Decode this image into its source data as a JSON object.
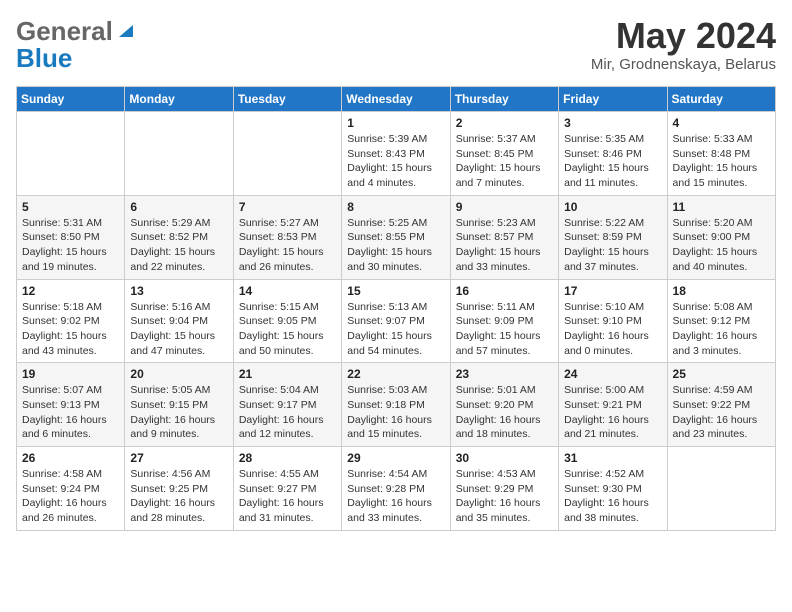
{
  "header": {
    "logo": {
      "general": "General",
      "blue": "Blue"
    },
    "month": "May 2024",
    "location": "Mir, Grodnenskaya, Belarus"
  },
  "weekdays": [
    "Sunday",
    "Monday",
    "Tuesday",
    "Wednesday",
    "Thursday",
    "Friday",
    "Saturday"
  ],
  "weeks": [
    [
      {
        "day": "",
        "info": ""
      },
      {
        "day": "",
        "info": ""
      },
      {
        "day": "",
        "info": ""
      },
      {
        "day": "1",
        "info": "Sunrise: 5:39 AM\nSunset: 8:43 PM\nDaylight: 15 hours\nand 4 minutes."
      },
      {
        "day": "2",
        "info": "Sunrise: 5:37 AM\nSunset: 8:45 PM\nDaylight: 15 hours\nand 7 minutes."
      },
      {
        "day": "3",
        "info": "Sunrise: 5:35 AM\nSunset: 8:46 PM\nDaylight: 15 hours\nand 11 minutes."
      },
      {
        "day": "4",
        "info": "Sunrise: 5:33 AM\nSunset: 8:48 PM\nDaylight: 15 hours\nand 15 minutes."
      }
    ],
    [
      {
        "day": "5",
        "info": "Sunrise: 5:31 AM\nSunset: 8:50 PM\nDaylight: 15 hours\nand 19 minutes."
      },
      {
        "day": "6",
        "info": "Sunrise: 5:29 AM\nSunset: 8:52 PM\nDaylight: 15 hours\nand 22 minutes."
      },
      {
        "day": "7",
        "info": "Sunrise: 5:27 AM\nSunset: 8:53 PM\nDaylight: 15 hours\nand 26 minutes."
      },
      {
        "day": "8",
        "info": "Sunrise: 5:25 AM\nSunset: 8:55 PM\nDaylight: 15 hours\nand 30 minutes."
      },
      {
        "day": "9",
        "info": "Sunrise: 5:23 AM\nSunset: 8:57 PM\nDaylight: 15 hours\nand 33 minutes."
      },
      {
        "day": "10",
        "info": "Sunrise: 5:22 AM\nSunset: 8:59 PM\nDaylight: 15 hours\nand 37 minutes."
      },
      {
        "day": "11",
        "info": "Sunrise: 5:20 AM\nSunset: 9:00 PM\nDaylight: 15 hours\nand 40 minutes."
      }
    ],
    [
      {
        "day": "12",
        "info": "Sunrise: 5:18 AM\nSunset: 9:02 PM\nDaylight: 15 hours\nand 43 minutes."
      },
      {
        "day": "13",
        "info": "Sunrise: 5:16 AM\nSunset: 9:04 PM\nDaylight: 15 hours\nand 47 minutes."
      },
      {
        "day": "14",
        "info": "Sunrise: 5:15 AM\nSunset: 9:05 PM\nDaylight: 15 hours\nand 50 minutes."
      },
      {
        "day": "15",
        "info": "Sunrise: 5:13 AM\nSunset: 9:07 PM\nDaylight: 15 hours\nand 54 minutes."
      },
      {
        "day": "16",
        "info": "Sunrise: 5:11 AM\nSunset: 9:09 PM\nDaylight: 15 hours\nand 57 minutes."
      },
      {
        "day": "17",
        "info": "Sunrise: 5:10 AM\nSunset: 9:10 PM\nDaylight: 16 hours\nand 0 minutes."
      },
      {
        "day": "18",
        "info": "Sunrise: 5:08 AM\nSunset: 9:12 PM\nDaylight: 16 hours\nand 3 minutes."
      }
    ],
    [
      {
        "day": "19",
        "info": "Sunrise: 5:07 AM\nSunset: 9:13 PM\nDaylight: 16 hours\nand 6 minutes."
      },
      {
        "day": "20",
        "info": "Sunrise: 5:05 AM\nSunset: 9:15 PM\nDaylight: 16 hours\nand 9 minutes."
      },
      {
        "day": "21",
        "info": "Sunrise: 5:04 AM\nSunset: 9:17 PM\nDaylight: 16 hours\nand 12 minutes."
      },
      {
        "day": "22",
        "info": "Sunrise: 5:03 AM\nSunset: 9:18 PM\nDaylight: 16 hours\nand 15 minutes."
      },
      {
        "day": "23",
        "info": "Sunrise: 5:01 AM\nSunset: 9:20 PM\nDaylight: 16 hours\nand 18 minutes."
      },
      {
        "day": "24",
        "info": "Sunrise: 5:00 AM\nSunset: 9:21 PM\nDaylight: 16 hours\nand 21 minutes."
      },
      {
        "day": "25",
        "info": "Sunrise: 4:59 AM\nSunset: 9:22 PM\nDaylight: 16 hours\nand 23 minutes."
      }
    ],
    [
      {
        "day": "26",
        "info": "Sunrise: 4:58 AM\nSunset: 9:24 PM\nDaylight: 16 hours\nand 26 minutes."
      },
      {
        "day": "27",
        "info": "Sunrise: 4:56 AM\nSunset: 9:25 PM\nDaylight: 16 hours\nand 28 minutes."
      },
      {
        "day": "28",
        "info": "Sunrise: 4:55 AM\nSunset: 9:27 PM\nDaylight: 16 hours\nand 31 minutes."
      },
      {
        "day": "29",
        "info": "Sunrise: 4:54 AM\nSunset: 9:28 PM\nDaylight: 16 hours\nand 33 minutes."
      },
      {
        "day": "30",
        "info": "Sunrise: 4:53 AM\nSunset: 9:29 PM\nDaylight: 16 hours\nand 35 minutes."
      },
      {
        "day": "31",
        "info": "Sunrise: 4:52 AM\nSunset: 9:30 PM\nDaylight: 16 hours\nand 38 minutes."
      },
      {
        "day": "",
        "info": ""
      }
    ]
  ]
}
